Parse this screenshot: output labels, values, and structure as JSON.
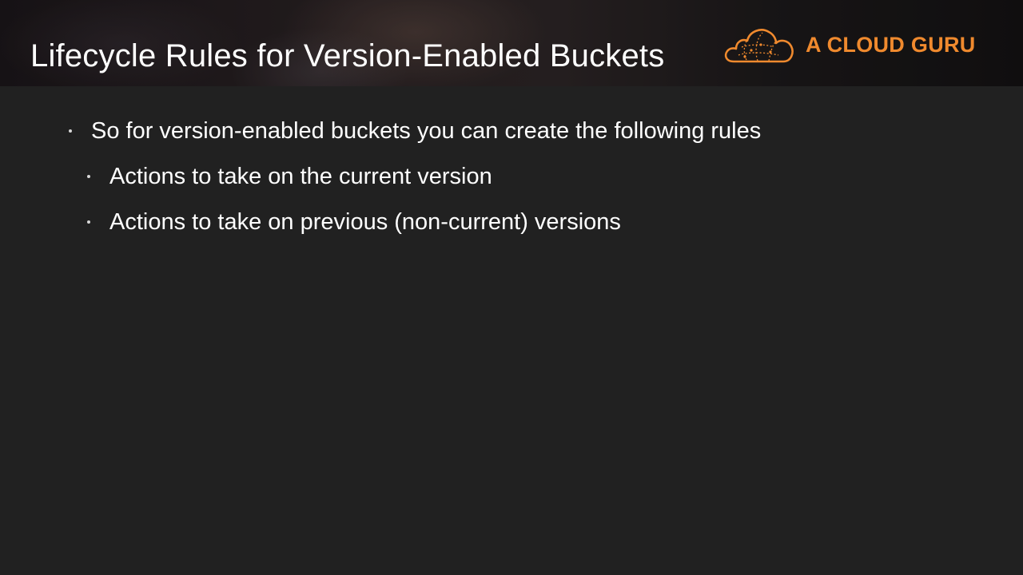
{
  "slide": {
    "title": "Lifecycle Rules for Version-Enabled Buckets",
    "brand": {
      "logo_icon": "cloud-logo-icon",
      "text": "A CLOUD GURU",
      "color": "#f08a2e"
    },
    "bullets": [
      {
        "level": 1,
        "text": "So for version-enabled buckets you can create the following rules"
      },
      {
        "level": 2,
        "text": "Actions to take on the current version"
      },
      {
        "level": 2,
        "text": "Actions to take on previous (non-current) versions"
      }
    ]
  },
  "colors": {
    "background": "#212121",
    "text": "#ffffff",
    "accent": "#f08a2e"
  }
}
